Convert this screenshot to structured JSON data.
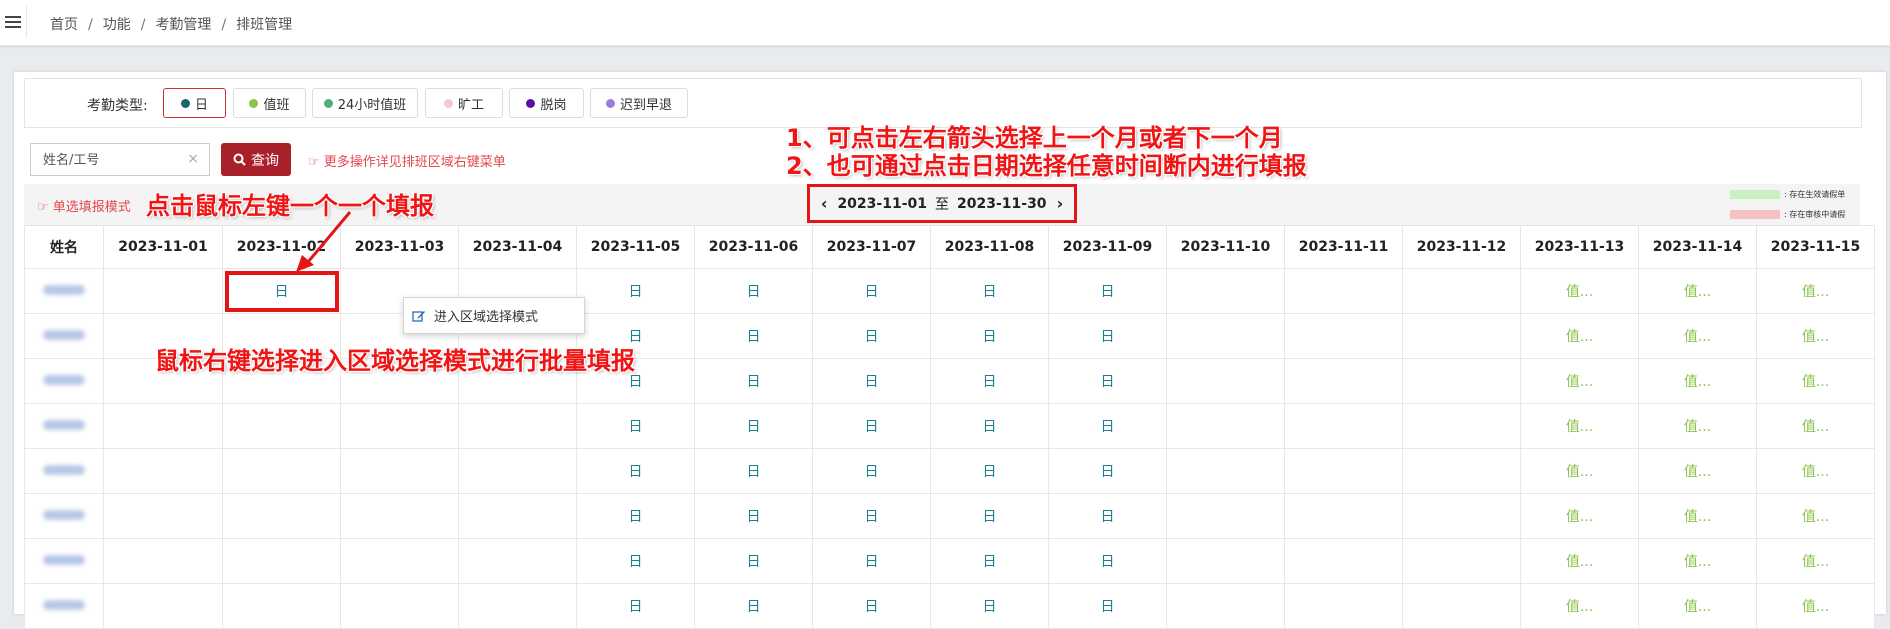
{
  "breadcrumb": [
    "首页",
    "功能",
    "考勤管理",
    "排班管理"
  ],
  "attendance_types": {
    "label": "考勤类型:",
    "items": [
      {
        "label": "日",
        "color": "#1a6670",
        "active": true
      },
      {
        "label": "值班",
        "color": "#8bc34a",
        "active": false
      },
      {
        "label": "24小时值班",
        "color": "#4caf7d",
        "active": false
      },
      {
        "label": "旷工",
        "color": "#f3c9cf",
        "active": false
      },
      {
        "label": "脱岗",
        "color": "#5b0ea8",
        "active": false
      },
      {
        "label": "迟到早退",
        "color": "#9b7be0",
        "active": false
      }
    ]
  },
  "search": {
    "placeholder": "姓名/工号",
    "clear": "×",
    "query_label": "查询"
  },
  "tips": {
    "more_ops": "更多操作详见排班区域右键菜单",
    "single_mode": "单选填报模式"
  },
  "date_range": {
    "start": "2023-11-01",
    "sep": "至",
    "end": "2023-11-30",
    "prev": "‹",
    "next": "›"
  },
  "legend": [
    {
      "label": ": 存在生效请假单",
      "color": "#c8f0c0"
    },
    {
      "label": ": 存在审核中请假",
      "color": "#f4c2c4"
    }
  ],
  "table": {
    "name_header": "姓名",
    "dates": [
      "2023-11-01",
      "2023-11-02",
      "2023-11-03",
      "2023-11-04",
      "2023-11-05",
      "2023-11-06",
      "2023-11-07",
      "2023-11-08",
      "2023-11-09",
      "2023-11-10",
      "2023-11-11",
      "2023-11-12",
      "2023-11-13",
      "2023-11-14",
      "2023-11-15"
    ],
    "rows": [
      [
        "",
        "日",
        "",
        "",
        "日",
        "日",
        "日",
        "日",
        "日",
        "",
        "",
        "",
        "值...",
        "值...",
        "值..."
      ],
      [
        "",
        "",
        "",
        "",
        "日",
        "日",
        "日",
        "日",
        "日",
        "",
        "",
        "",
        "值...",
        "值...",
        "值..."
      ],
      [
        "",
        "",
        "",
        "",
        "日",
        "日",
        "日",
        "日",
        "日",
        "",
        "",
        "",
        "值...",
        "值...",
        "值..."
      ],
      [
        "",
        "",
        "",
        "",
        "日",
        "日",
        "日",
        "日",
        "日",
        "",
        "",
        "",
        "值...",
        "值...",
        "值..."
      ],
      [
        "",
        "",
        "",
        "",
        "日",
        "日",
        "日",
        "日",
        "日",
        "",
        "",
        "",
        "值...",
        "值...",
        "值..."
      ],
      [
        "",
        "",
        "",
        "",
        "日",
        "日",
        "日",
        "日",
        "日",
        "",
        "",
        "",
        "值...",
        "值...",
        "值..."
      ],
      [
        "",
        "",
        "",
        "",
        "日",
        "日",
        "日",
        "日",
        "日",
        "",
        "",
        "",
        "值...",
        "值...",
        "值..."
      ],
      [
        "",
        "",
        "",
        "",
        "日",
        "日",
        "日",
        "日",
        "日",
        "",
        "",
        "",
        "值...",
        "值...",
        "值..."
      ]
    ]
  },
  "context_menu": {
    "label": "进入区域选择模式"
  },
  "annotations": {
    "nav_line1": "1、可点击左右箭头选择上一个月或者下一个月",
    "nav_line2": "2、也可通过点击日期选择任意时间断内进行填报",
    "left_click": "点击鼠标左键一个一个填报",
    "right_click": "鼠标右键选择进入区域选择模式进行批量填报"
  },
  "colors": {
    "accent": "#a8202a",
    "highlight": "#e31616",
    "day_text": "#1a7f8e",
    "duty_text": "#8bc34a"
  }
}
